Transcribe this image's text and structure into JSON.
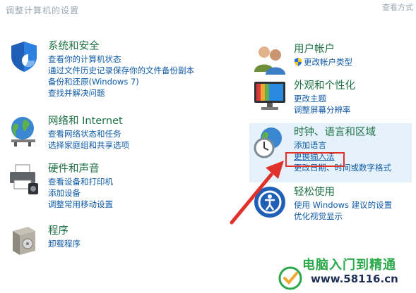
{
  "window": {
    "title": "调整计算机的设置",
    "view_mode": "查看方式"
  },
  "left_column": [
    {
      "title": "系统和安全",
      "icon": "shield-icon",
      "links": [
        "查看你的计算机状态",
        "通过文件历史记录保存你的文件备份副本",
        "备份和还原(Windows 7)",
        "查找并解决问题"
      ]
    },
    {
      "title": "网络和 Internet",
      "icon": "globe-network-icon",
      "links": [
        "查看网络状态和任务",
        "选择家庭组和共享选项"
      ]
    },
    {
      "title": "硬件和声音",
      "icon": "printer-icon",
      "links": [
        "查看设备和打印机",
        "添加设备",
        "调整常用移动设置"
      ]
    },
    {
      "title": "程序",
      "icon": "programs-box-icon",
      "links": [
        "卸载程序"
      ]
    }
  ],
  "right_column": [
    {
      "title": "用户帐户",
      "icon": "users-icon",
      "links": [
        "更改帐户类型"
      ]
    },
    {
      "title": "外观和个性化",
      "icon": "monitor-icon",
      "links": [
        "更改主题",
        "调整屏幕分辨率"
      ]
    },
    {
      "title": "时钟、语言和区域",
      "icon": "clock-globe-icon",
      "links": [
        "添加语言",
        "更换输入法",
        "更改日期、时间或数字格式"
      ]
    },
    {
      "title": "轻松使用",
      "icon": "ease-of-access-icon",
      "links": [
        "使用 Windows 建议的设置",
        "优化视觉显示"
      ]
    }
  ],
  "highlight": {
    "link": "更换输入法",
    "color": "#e0322b"
  },
  "watermark": {
    "line1": "电脑入门到精通",
    "line2": "www.58116.cn"
  },
  "colors": {
    "category_title": "#1e7145",
    "link": "#0e5aa7",
    "hover_background": "#e5f1fb"
  }
}
